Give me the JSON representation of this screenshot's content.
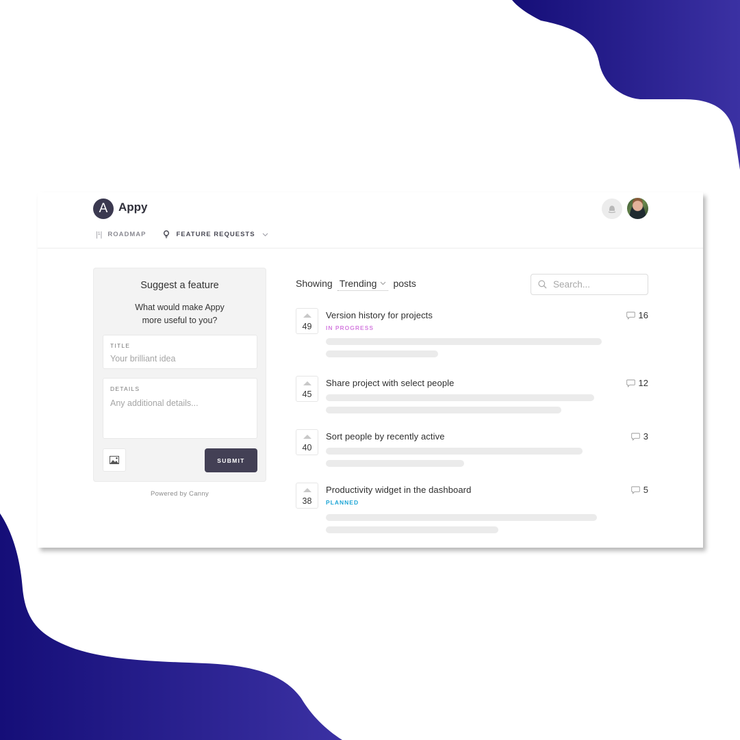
{
  "colors": {
    "brand_dark": "#434055",
    "blob_start": "#150e78",
    "blob_end": "#3b31a3",
    "status_in_progress": "#d57fe0",
    "status_planned": "#1fa6d6"
  },
  "header": {
    "logo_letter": "A",
    "app_name": "Appy",
    "nav": [
      {
        "label": "ROADMAP",
        "icon": "roadmap-icon"
      },
      {
        "label": "FEATURE REQUESTS",
        "icon": "lightbulb-icon",
        "active": true
      }
    ],
    "notifications_icon": "bell-icon",
    "avatar": "user-avatar"
  },
  "suggest": {
    "title": "Suggest a feature",
    "subtitle_line1": "What would make Appy",
    "subtitle_line2": "more useful to you?",
    "title_label": "TITLE",
    "title_placeholder": "Your brilliant idea",
    "details_label": "DETAILS",
    "details_placeholder": "Any additional details...",
    "attach_icon": "image-icon",
    "submit_label": "SUBMIT",
    "powered_by": "Powered by Canny"
  },
  "feed": {
    "showing_label": "Showing",
    "sort_value": "Trending",
    "posts_label": "posts",
    "search_placeholder": "Search...",
    "posts": [
      {
        "votes": "49",
        "title": "Version history for projects",
        "status": "IN PROGRESS",
        "comments": "16"
      },
      {
        "votes": "45",
        "title": "Share project with select people",
        "status": "",
        "comments": "12"
      },
      {
        "votes": "40",
        "title": "Sort people by recently active",
        "status": "",
        "comments": "3"
      },
      {
        "votes": "38",
        "title": "Productivity widget in the dashboard",
        "status": "PLANNED",
        "comments": "5"
      }
    ]
  }
}
